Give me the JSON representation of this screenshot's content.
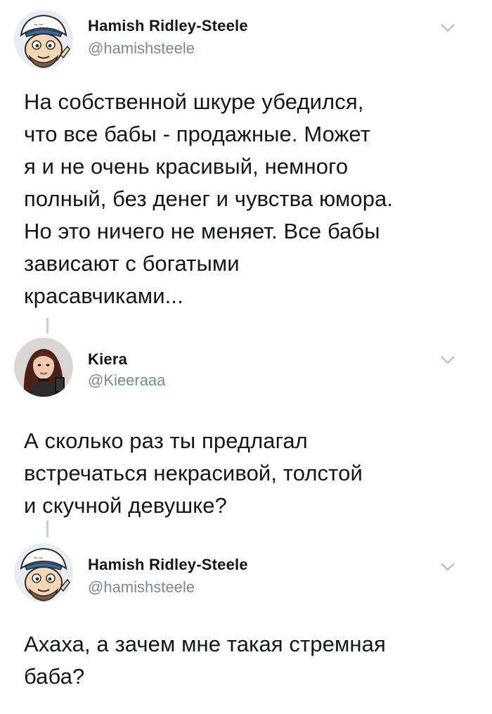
{
  "tweets": [
    {
      "name": "Hamish Ridley-Steele",
      "handle": "@hamishsteele",
      "avatar": "cartoon-man-avatar-icon",
      "text": "На собственной шкуре убедился,\nчто все бабы - продажные. Может\nя и не очень красивый, немного\nполный, без денег и чувства юмора.\nНо это ничего не меняет. Все бабы\nзависают с богатыми\nкрасавчиками..."
    },
    {
      "name": "Kiera",
      "handle": "@Kieeraaa",
      "avatar": "woman-selfie-avatar-icon",
      "text": "А сколько раз ты предлагал\nвстречаться некрасивой, толстой\nи скучной девушке?"
    },
    {
      "name": "Hamish Ridley-Steele",
      "handle": "@hamishsteele",
      "avatar": "cartoon-man-avatar-icon",
      "text": "Ахаха, а зачем мне такая стремная\nбаба?"
    }
  ],
  "colors": {
    "name": "#14171a",
    "handle": "#7b8893",
    "thread_line": "#c6ced6",
    "chevron": "#aab8c2"
  }
}
